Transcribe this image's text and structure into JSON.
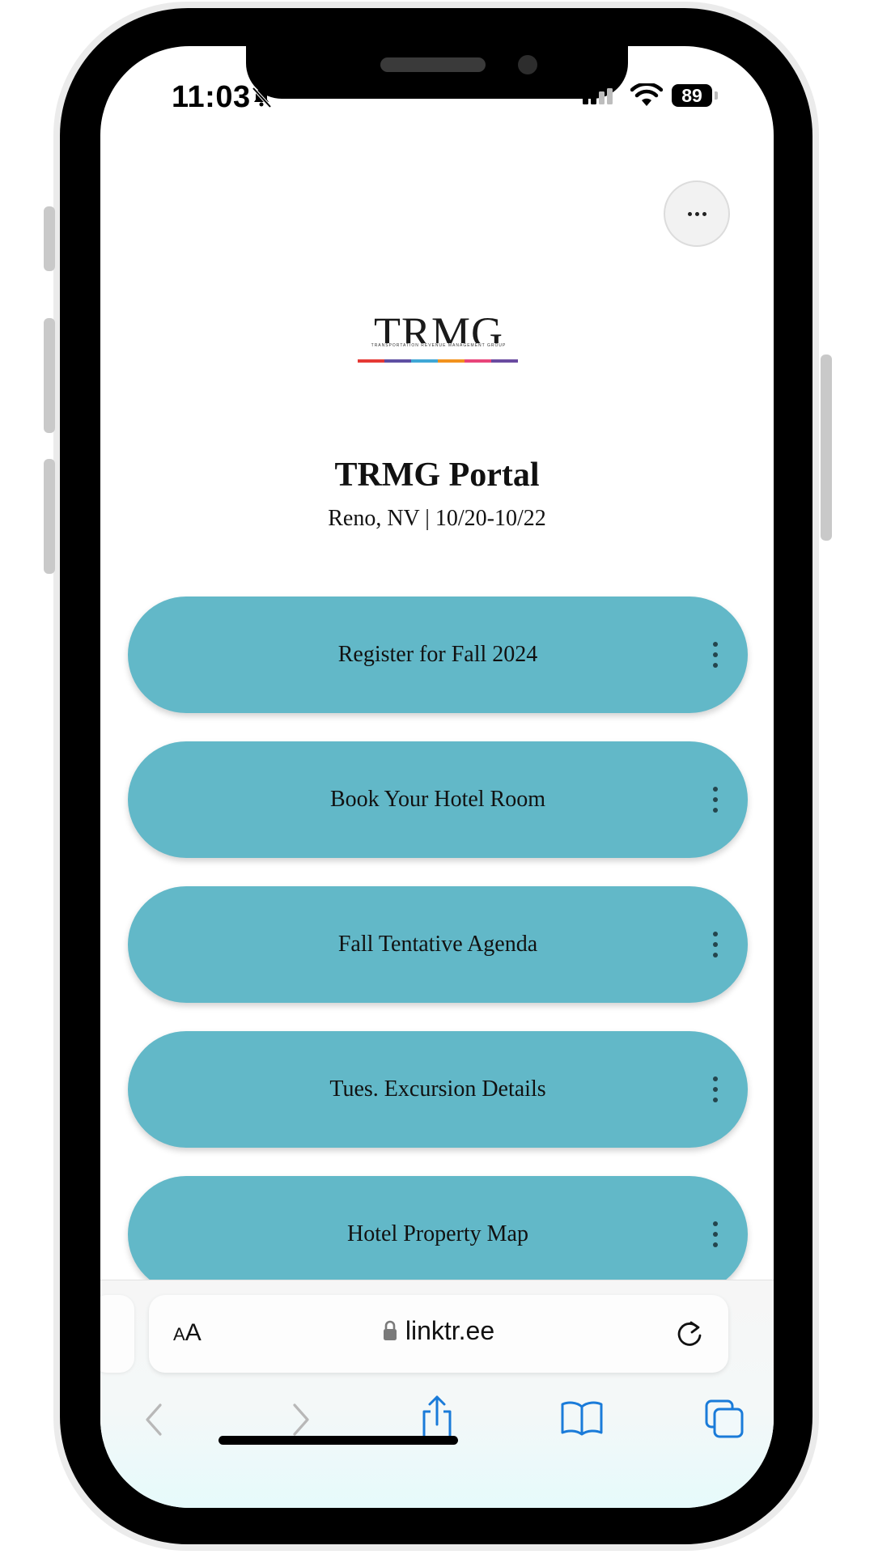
{
  "status_bar": {
    "time": "11:03",
    "battery_percent": "89"
  },
  "page": {
    "logo_text": "TRMG",
    "logo_tagline": "TRANSPORTATION REVENUE MANAGEMENT GROUP",
    "title": "TRMG Portal",
    "subtitle": "Reno, NV | 10/20-10/22"
  },
  "links": [
    {
      "label": "Register for Fall 2024"
    },
    {
      "label": "Book Your Hotel Room"
    },
    {
      "label": "Fall Tentative Agenda"
    },
    {
      "label": "Tues. Excursion Details"
    },
    {
      "label": "Hotel Property Map"
    }
  ],
  "browser": {
    "text_size_small": "A",
    "text_size_large": "A",
    "url": "linktr.ee"
  },
  "colors": {
    "link_button": "#62b8c8",
    "ios_blue": "#1a7bd9",
    "logo_stripe": [
      "#e53935",
      "#5e4fa2",
      "#3fa7d6",
      "#f2921d",
      "#e8457a",
      "#6a4ba0"
    ]
  },
  "icons": {
    "more": "more-dots-icon",
    "link_menu": "kebab-icon",
    "back": "chevron-left-icon",
    "forward": "chevron-right-icon",
    "share": "share-icon",
    "bookmarks": "book-icon",
    "tabs": "tabs-icon"
  }
}
